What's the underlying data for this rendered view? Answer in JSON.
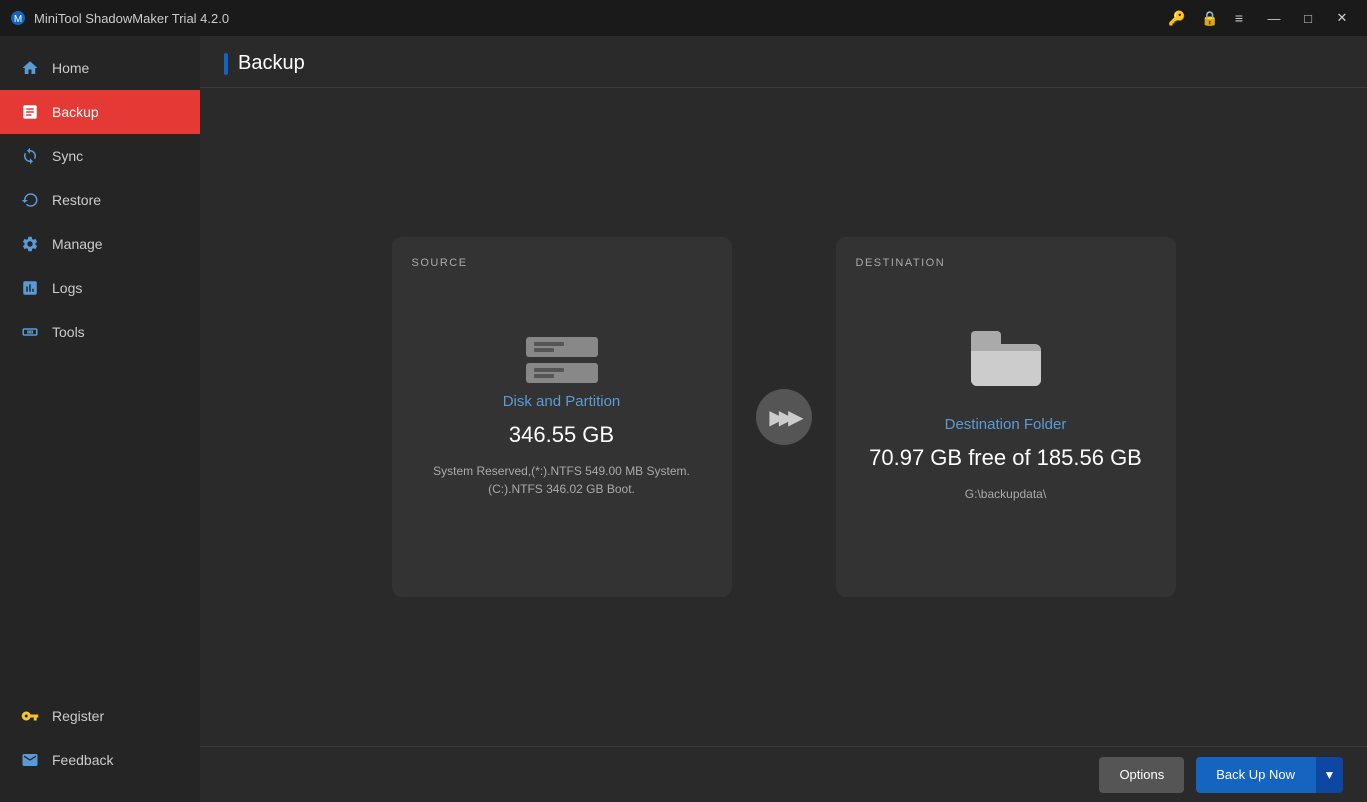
{
  "titleBar": {
    "title": "MiniTool ShadowMaker Trial 4.2.0",
    "minimize": "—",
    "maximize": "□",
    "close": "✕"
  },
  "sidebar": {
    "items": [
      {
        "id": "home",
        "label": "Home",
        "icon": "🏠",
        "active": false
      },
      {
        "id": "backup",
        "label": "Backup",
        "icon": "🗂",
        "active": true
      },
      {
        "id": "sync",
        "label": "Sync",
        "icon": "🔄",
        "active": false
      },
      {
        "id": "restore",
        "label": "Restore",
        "icon": "🔁",
        "active": false
      },
      {
        "id": "manage",
        "label": "Manage",
        "icon": "⚙",
        "active": false
      },
      {
        "id": "logs",
        "label": "Logs",
        "icon": "📋",
        "active": false
      },
      {
        "id": "tools",
        "label": "Tools",
        "icon": "🧰",
        "active": false
      }
    ],
    "footer": [
      {
        "id": "register",
        "label": "Register",
        "icon": "🔑"
      },
      {
        "id": "feedback",
        "label": "Feedback",
        "icon": "✉"
      }
    ]
  },
  "pageTitle": "Backup",
  "source": {
    "label": "SOURCE",
    "iconType": "disk",
    "name": "Disk and Partition",
    "size": "346.55 GB",
    "desc": "System Reserved,(*:).NTFS 549.00 MB System. (C:).NTFS 346.02 GB Boot."
  },
  "destination": {
    "label": "DESTINATION",
    "iconType": "folder",
    "name": "Destination Folder",
    "freeOf": "70.97 GB free of 185.56 GB",
    "path": "G:\\backupdata\\"
  },
  "bottomBar": {
    "optionsLabel": "Options",
    "backupLabel": "Back Up Now",
    "arrowLabel": "▼"
  }
}
